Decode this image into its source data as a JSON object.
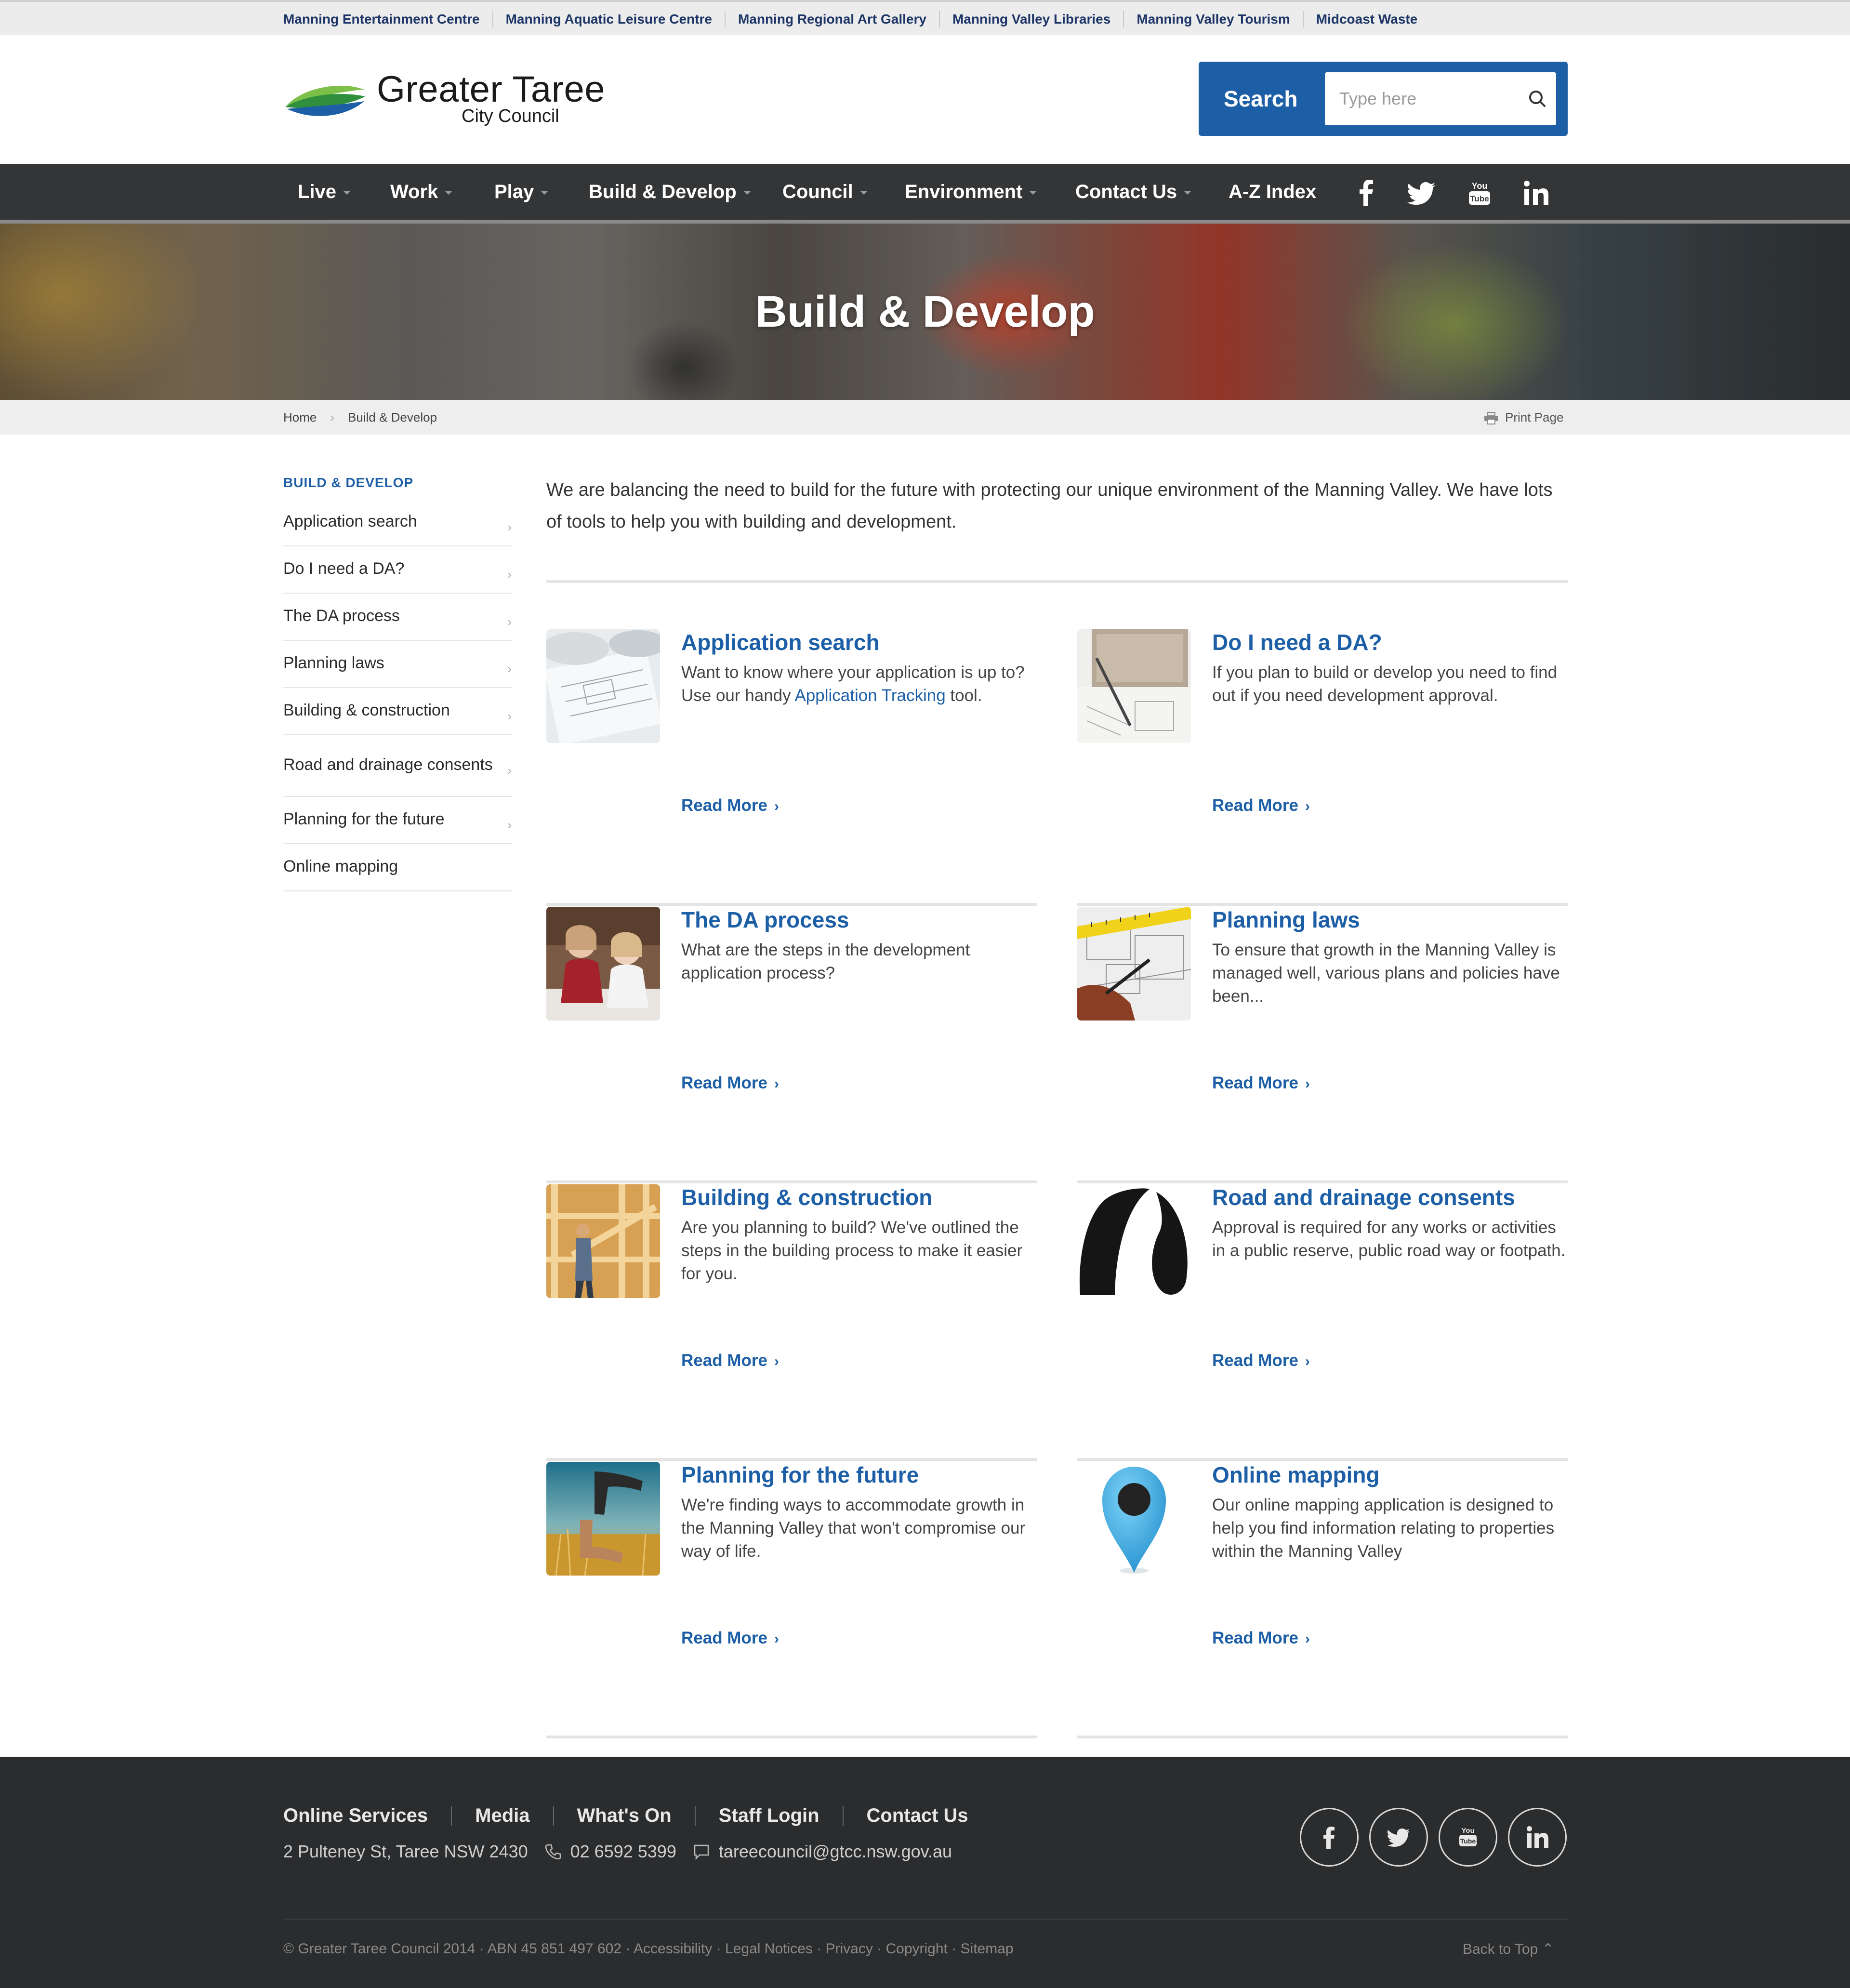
{
  "utility_links": [
    "Manning Entertainment Centre",
    "Manning Aquatic Leisure Centre",
    "Manning Regional Art Gallery",
    "Manning Valley Libraries",
    "Manning Valley Tourism",
    "Midcoast Waste"
  ],
  "logo": {
    "title": "Greater Taree",
    "subtitle": "City Council"
  },
  "search": {
    "label": "Search",
    "placeholder": "Type here"
  },
  "nav": {
    "items": [
      "Live",
      "Work",
      "Play",
      "Build & Develop",
      "Council",
      "Environment",
      "Contact Us",
      "A-Z Index"
    ],
    "social_icons": [
      "facebook-icon",
      "twitter-icon",
      "youtube-icon",
      "linkedin-icon"
    ]
  },
  "hero": {
    "title": "Build & Develop"
  },
  "breadcrumb": {
    "items": [
      "Home",
      "Build & Develop"
    ],
    "print_label": "Print Page"
  },
  "sidebar": {
    "heading": "BUILD & DEVELOP",
    "items": [
      "Application search",
      "Do I need a DA?",
      "The DA process",
      "Planning laws",
      "Building & construction",
      "Road and drainage consents",
      "Planning for the future",
      "Online mapping"
    ]
  },
  "intro": "We are balancing the need to build for the future with protecting our unique environment of the Manning Valley. We have lots of tools to help you with building and development.",
  "cards": [
    {
      "title": "Application search",
      "desc_before": "Want to know where your application is up to? Use our handy ",
      "desc_link": "Application Tracking",
      "desc_after": " tool.",
      "more": "Read More"
    },
    {
      "title": "Do I need a DA?",
      "desc": "If you plan to build or develop you need to find out if you need development approval.",
      "more": "Read More"
    },
    {
      "title": "The DA process",
      "desc": "What are the steps in the development application process?",
      "more": "Read More"
    },
    {
      "title": "Planning laws",
      "desc": "To ensure that growth in the Manning Valley is managed well, various plans and policies have been...",
      "more": "Read More"
    },
    {
      "title": "Building & construction",
      "desc": "Are you planning to build? We've outlined the steps in the building process to make it easier for you.",
      "more": "Read More"
    },
    {
      "title": "Road and drainage consents",
      "desc": "Approval is required for any works or activities in a public reserve, public road way or footpath.",
      "more": "Read More"
    },
    {
      "title": "Planning for the future",
      "desc": "We're finding ways to accommodate growth in the Manning Valley that won't compromise our way of life.",
      "more": "Read More"
    },
    {
      "title": "Online mapping",
      "desc": "Our online mapping application is designed to help you find information relating to properties within the Manning Valley",
      "more": "Read More"
    }
  ],
  "footer": {
    "links": [
      "Online Services",
      "Media",
      "What's On",
      "Staff Login",
      "Contact Us"
    ],
    "address": "2 Pulteney St, Taree NSW 2430",
    "phone": "02 6592 5399",
    "email": "tareecouncil@gtcc.nsw.gov.au",
    "copyright": "© Greater Taree Council 2014 · ABN 45 851 497 602 · Accessibility · Legal Notices · Privacy · Copyright · Sitemap",
    "back_to_top": "Back to Top"
  },
  "colors": {
    "brand_blue": "#1d5fa6",
    "nav_bg": "#333537",
    "footer_bg": "#2b2c2e",
    "utility_link": "#1c3466"
  }
}
